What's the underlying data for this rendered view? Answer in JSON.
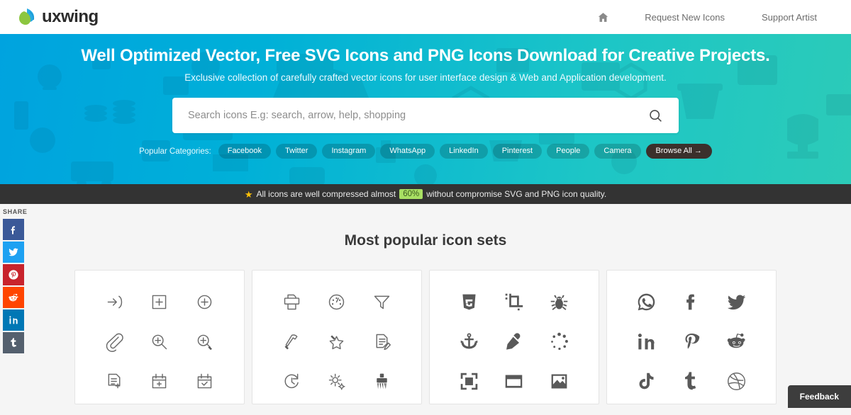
{
  "header": {
    "brand": "uxwing",
    "nav": [
      {
        "name": "home",
        "label": "",
        "icon": "home-icon"
      },
      {
        "name": "request-new-icons",
        "label": "Request New Icons"
      },
      {
        "name": "support-artist",
        "label": "Support Artist"
      }
    ]
  },
  "hero": {
    "title": "Well Optimized Vector, Free SVG Icons and PNG Icons Download for Creative Projects.",
    "subtitle": "Exclusive collection of carefully crafted vector icons for user interface design & Web and Application development.",
    "gradient_from": "#00a3df",
    "gradient_to": "#2ccbb8",
    "search": {
      "placeholder": "Search icons E.g: search, arrow, help, shopping",
      "value": "",
      "button_icon": "search-icon"
    },
    "categories_label": "Popular Categories:",
    "categories": [
      "Facebook",
      "Twitter",
      "Instagram",
      "WhatsApp",
      "LinkedIn",
      "Pinterest",
      "People",
      "Camera"
    ],
    "browse_all": "Browse All →"
  },
  "notice": {
    "icon": "star-icon",
    "text_before": "All icons are well compressed almost",
    "badge": "60%",
    "badge_color": "#a8e063",
    "text_after": "without compromise SVG and PNG icon quality."
  },
  "share": {
    "label": "SHARE",
    "items": [
      {
        "name": "facebook",
        "color": "#3b5998"
      },
      {
        "name": "twitter",
        "color": "#1da1f2"
      },
      {
        "name": "pinterest",
        "color": "#c8232c"
      },
      {
        "name": "reddit",
        "color": "#ff4500"
      },
      {
        "name": "linkedin",
        "color": "#0077b5"
      },
      {
        "name": "tumblr",
        "color": "#54606e"
      }
    ]
  },
  "main": {
    "section_title": "Most popular icon sets",
    "cards": [
      {
        "name": "card-line-icons",
        "icons": [
          "login-arrow-icon",
          "add-square-icon",
          "add-circle-icon",
          "paperclip-icon",
          "zoom-in-icon",
          "zoom-in-alt-icon",
          "document-add-icon",
          "calendar-add-icon",
          "calendar-check-icon"
        ]
      },
      {
        "name": "card-tool-icons",
        "icons": [
          "printer-icon",
          "gauge-icon",
          "funnel-filter-icon",
          "hammer-icon",
          "magic-wand-icon",
          "edit-document-icon",
          "refresh-clock-icon",
          "settings-gears-icon",
          "brush-icon"
        ]
      },
      {
        "name": "card-solid-icons",
        "icons": [
          "html5-icon",
          "crop-icon",
          "bug-icon",
          "anchor-icon",
          "eyedropper-icon",
          "loading-spinner-icon",
          "fullscreen-icon",
          "browser-window-icon",
          "image-icon"
        ]
      },
      {
        "name": "card-social-icons",
        "icons": [
          "whatsapp-icon",
          "facebook-icon",
          "twitter-icon",
          "linkedin-icon",
          "pinterest-icon",
          "reddit-icon",
          "tiktok-icon",
          "tumblr-icon",
          "dribbble-icon"
        ]
      }
    ]
  },
  "feedback": {
    "label": "Feedback"
  }
}
